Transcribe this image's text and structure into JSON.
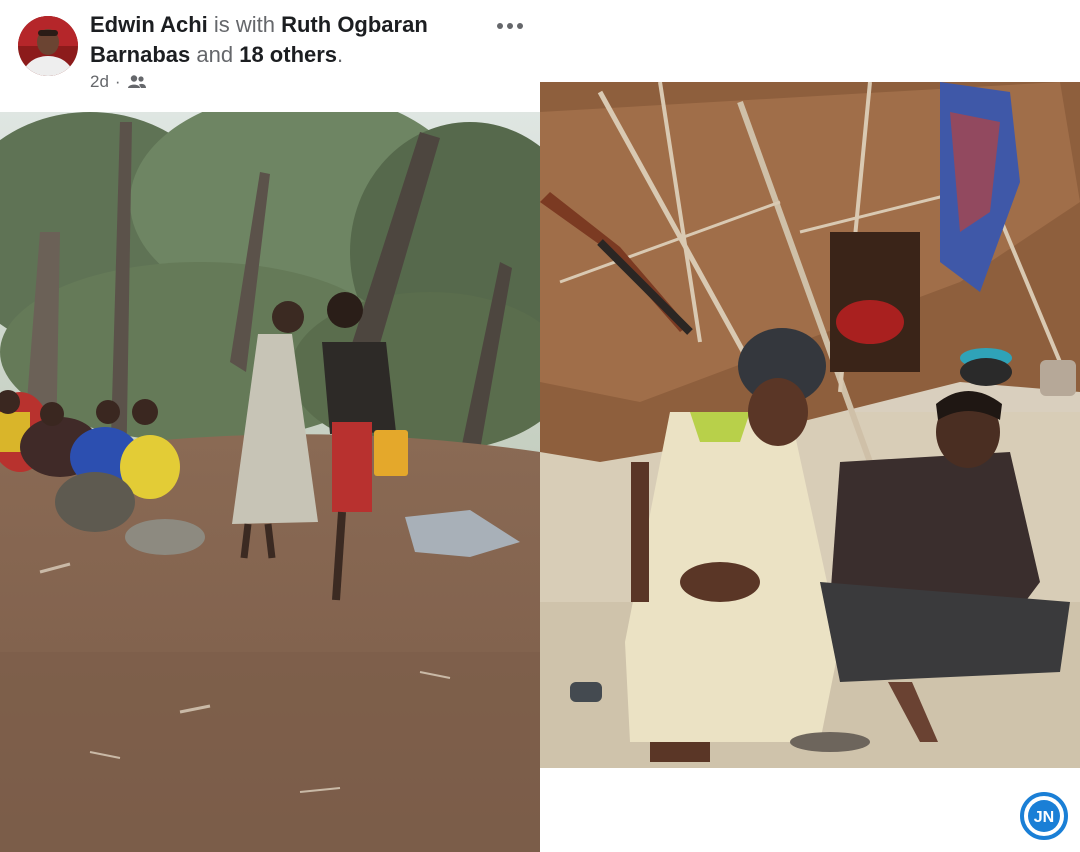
{
  "post": {
    "author": "Edwin Achi",
    "with_text": " is with ",
    "tagged": "Ruth Ogbaran Barnabas",
    "and_text": " and ",
    "others": "18 others",
    "period": ".",
    "time": "2d",
    "separator": "·",
    "audience_icon": "friends-icon",
    "more_icon": "more-options-icon"
  },
  "watermark": {
    "text": "JN",
    "color": "#1a7fd6"
  },
  "colors": {
    "name": "#1c1e21",
    "secondary": "#65676b"
  }
}
